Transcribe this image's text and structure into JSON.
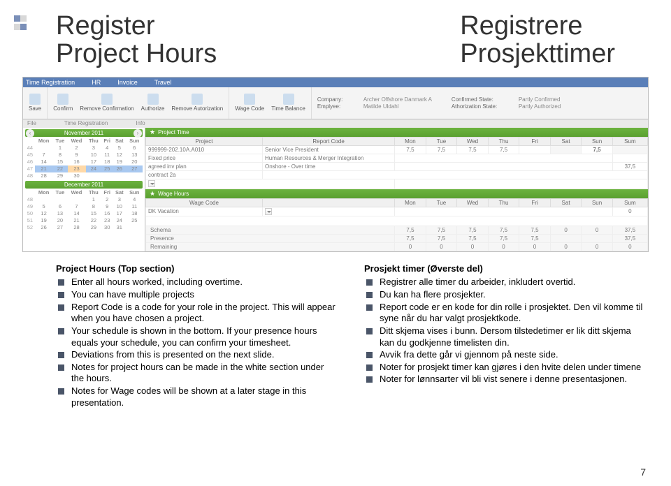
{
  "titles": {
    "left1": "Register",
    "left2": "Project Hours",
    "right1": "Registrere",
    "right2": "Prosjekttimer"
  },
  "app": {
    "header_tabs": [
      "HR",
      "Invoice",
      "Travel"
    ],
    "title_bar": "Time Registration",
    "toolbar_buttons": [
      "Save",
      "Confirm",
      "Remove Confirmation",
      "Authorize",
      "Remove Autorization",
      "Wage Code",
      "Time Balance"
    ],
    "toolbar_groups": [
      "File",
      "Time Registration",
      "Info"
    ],
    "info_labels": {
      "company": "Company:",
      "employee": "Emplyee:",
      "conf_state": "Confirmed State:",
      "auth_state": "Athorization State:"
    },
    "info_values": {
      "company": "Archer Offshore Danmark A",
      "employee": "Matilde Uldahl",
      "conf_state": "Partly Confirmed",
      "auth_state": "Partly Authorized"
    }
  },
  "cal1": {
    "title": "November 2011",
    "dow": [
      "",
      "Mon",
      "Tue",
      "Wed",
      "Thu",
      "Fri",
      "Sat",
      "Sun"
    ],
    "rows": [
      [
        "44",
        "",
        "1",
        "2",
        "3",
        "4",
        "5",
        "6"
      ],
      [
        "45",
        "7",
        "8",
        "9",
        "10",
        "11",
        "12",
        "13"
      ],
      [
        "46",
        "14",
        "15",
        "16",
        "17",
        "18",
        "19",
        "20"
      ],
      [
        "47",
        "21",
        "22",
        "23",
        "24",
        "25",
        "26",
        "27"
      ],
      [
        "48",
        "28",
        "29",
        "30",
        "",
        "",
        "",
        ""
      ]
    ],
    "sel_row": 3,
    "today_col": 3
  },
  "cal2": {
    "title": "December 2011",
    "dow": [
      "",
      "Mon",
      "Tue",
      "Wed",
      "Thu",
      "Fri",
      "Sat",
      "Sun"
    ],
    "rows": [
      [
        "48",
        "",
        "",
        "",
        "1",
        "2",
        "3",
        "4"
      ],
      [
        "49",
        "5",
        "6",
        "7",
        "8",
        "9",
        "10",
        "11"
      ],
      [
        "50",
        "12",
        "13",
        "14",
        "15",
        "16",
        "17",
        "18"
      ],
      [
        "51",
        "19",
        "20",
        "21",
        "22",
        "23",
        "24",
        "25"
      ],
      [
        "52",
        "26",
        "27",
        "28",
        "29",
        "30",
        "31",
        ""
      ]
    ]
  },
  "project_time": {
    "title": "Project Time",
    "cols": [
      "Project",
      "Report Code",
      "Mon",
      "Tue",
      "Wed",
      "Thu",
      "Fri",
      "Sat",
      "Sun",
      "Sum"
    ],
    "row": {
      "project": "999999-202.10A.A010",
      "extra": [
        "Fixed price",
        "agreed inv plan",
        "contract 2a"
      ],
      "report": [
        "Senior Vice President",
        "Human Resources & Merger Integration",
        "Onshore - Over time"
      ],
      "days": [
        "7,5",
        "7,5",
        "7,5",
        "7,5",
        "",
        "7,5",
        "",
        ""
      ],
      "sum": "37,5"
    }
  },
  "wage_hours": {
    "title": "Wage Hours",
    "cols": [
      "Wage Code",
      "",
      "Mon",
      "Tue",
      "Wed",
      "Thu",
      "Fri",
      "Sat",
      "Sun",
      "Sum"
    ],
    "row_label": "DK Vacation",
    "row_sum": "0",
    "bottom": [
      {
        "label": "Schema",
        "vals": [
          "7,5",
          "7,5",
          "7,5",
          "7,5",
          "7,5",
          "0",
          "0",
          "37,5"
        ]
      },
      {
        "label": "Presence",
        "vals": [
          "7,5",
          "7,5",
          "7,5",
          "7,5",
          "7,5",
          "",
          "",
          "37,5"
        ]
      },
      {
        "label": "Remaining",
        "vals": [
          "0",
          "0",
          "0",
          "0",
          "0",
          "0",
          "0",
          "0"
        ]
      }
    ]
  },
  "left_col": {
    "heading": "Project Hours (Top section)",
    "items": [
      "Enter all hours worked, including overtime.",
      "You can have multiple projects",
      "Report Code is a code for your role in the project. This will appear when you have chosen a project.",
      "Your schedule is shown in the bottom. If your presence hours equals your schedule, you can confirm your timesheet.",
      "Deviations from this is presented on the next slide.",
      "Notes for project hours can be made in the white section under the hours.",
      "Notes for Wage codes will be shown at a later stage in this presentation."
    ]
  },
  "right_col": {
    "heading": "Prosjekt timer  (Øverste del)",
    "items": [
      "Registrer alle timer du arbeider, inkludert overtid.",
      "Du kan ha flere prosjekter.",
      "Report code er en kode for din rolle i prosjektet. Den vil komme til syne når du har valgt prosjektkode.",
      "Ditt skjema vises i bunn. Dersom tilstedetimer er lik ditt skjema kan du godkjenne timelisten din.",
      "Avvik fra dette går vi gjennom på neste side.",
      "Noter for prosjekt timer kan gjøres i den hvite delen under timene",
      "Noter for lønnsarter vil bli vist senere i denne presentasjonen."
    ]
  },
  "page_number": "7"
}
